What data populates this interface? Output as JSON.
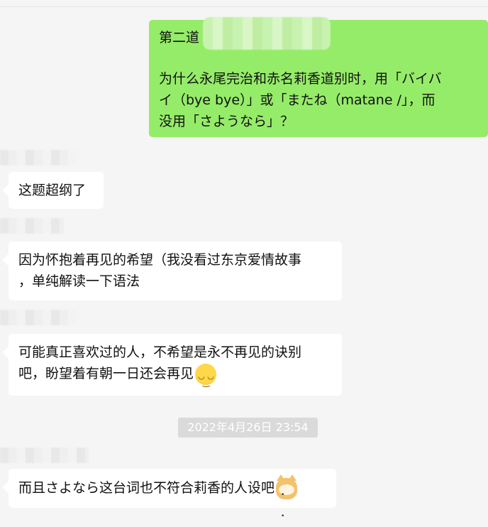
{
  "messages": {
    "out_q": {
      "line1_prefix": "第二道",
      "line2": "为什么永尾完治和赤名莉香道别时，用「バイバ",
      "line3": "イ（bye bye）」或「またね（matane /」，而",
      "line4": "没用「さようなら」？"
    },
    "in1": "这题超纲了",
    "in2_line1": "因为怀抱着再见的希望（我没看过东京爱情故事",
    "in2_line2": "，单纯解读一下语法",
    "in3_line1": "可能真正喜欢过的人，不希望是永不再见的诀别",
    "in3_line2": "吧，盼望着有朝一日还会再见",
    "timestamp": "2022年4月26日 23:54",
    "in4": "而且さよなら这台词也不符合莉香的人设吧"
  },
  "icons": {
    "smile_emoji": "smiling-face-emoji",
    "cat_emoji": "cat-face-emoji"
  },
  "colors": {
    "background": "#f5f5f5",
    "incoming_bubble": "#ffffff",
    "outgoing_bubble": "#95ec69",
    "timestamp_bg": "#dadada"
  }
}
